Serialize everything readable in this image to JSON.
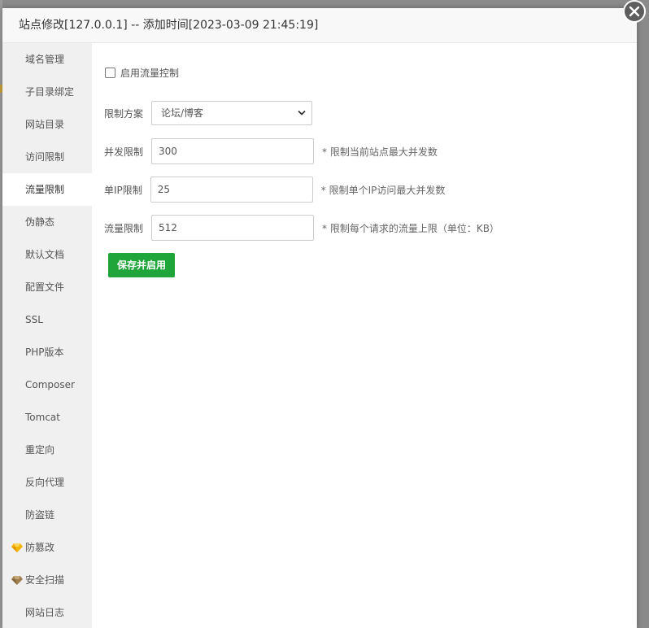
{
  "dialog": {
    "title": "站点修改[127.0.0.1] -- 添加时间[2023-03-09 21:45:19]"
  },
  "sidebar": {
    "items": [
      {
        "label": "域名管理"
      },
      {
        "label": "子目录绑定"
      },
      {
        "label": "网站目录"
      },
      {
        "label": "访问限制"
      },
      {
        "label": "流量限制",
        "active": true
      },
      {
        "label": "伪静态"
      },
      {
        "label": "默认文档"
      },
      {
        "label": "配置文件"
      },
      {
        "label": "SSL"
      },
      {
        "label": "PHP版本"
      },
      {
        "label": "Composer"
      },
      {
        "label": "Tomcat"
      },
      {
        "label": "重定向"
      },
      {
        "label": "反向代理"
      },
      {
        "label": "防盗链"
      },
      {
        "label": "防篡改",
        "icon": "gem-gold-icon"
      },
      {
        "label": "安全扫描",
        "icon": "gem-bronze-icon"
      },
      {
        "label": "网站日志"
      }
    ]
  },
  "form": {
    "enable_label": "启用流量控制",
    "enable_checked": false,
    "plan_label": "限制方案",
    "plan_value": "论坛/博客",
    "concurrency_label": "并发限制",
    "concurrency_value": "300",
    "concurrency_hint": "* 限制当前站点最大并发数",
    "per_ip_label": "单IP限制",
    "per_ip_value": "25",
    "per_ip_hint": "* 限制单个IP访问最大并发数",
    "rate_label": "流量限制",
    "rate_value": "512",
    "rate_hint": "* 限制每个请求的流量上限（单位：KB）",
    "save_label": "保存并启用"
  },
  "colors": {
    "primary": "#20a53a",
    "gem_gold": "#f5b400",
    "gem_bronze": "#a08050"
  }
}
